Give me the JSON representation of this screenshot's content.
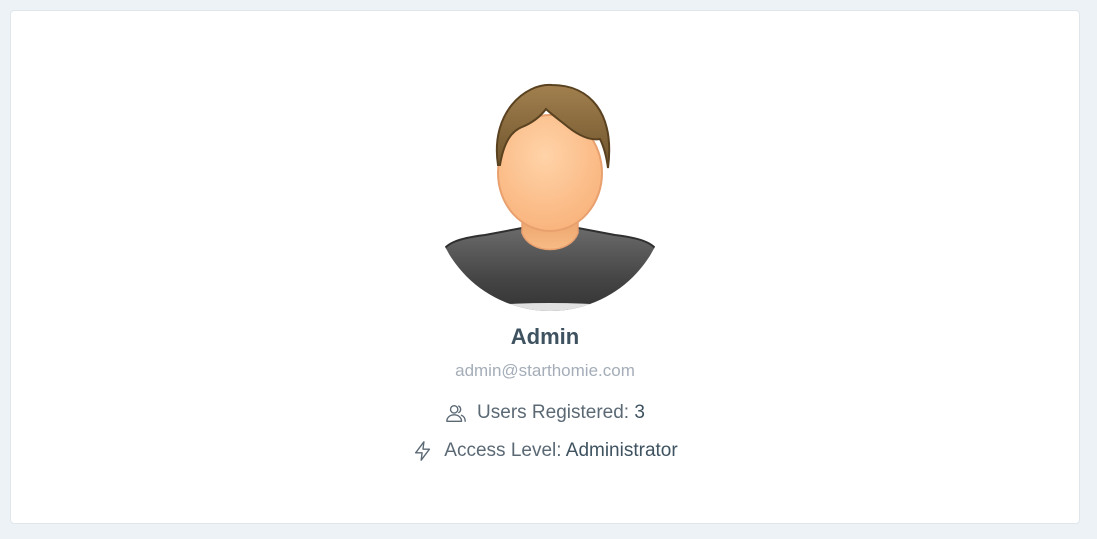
{
  "profile": {
    "name": "Admin",
    "email": "admin@starthomie.com"
  },
  "stats": {
    "users_label": "Users Registered:",
    "users_value": "3",
    "users_icon": "users-icon",
    "access_label": "Access Level:",
    "access_value": "Administrator",
    "access_icon": "lightning-icon"
  },
  "colors": {
    "hair": "#8a6a3c",
    "skin": "#fdc08e",
    "shirt": "#555555",
    "text_dark": "#3e5260",
    "text_muted": "#a4adb8"
  }
}
